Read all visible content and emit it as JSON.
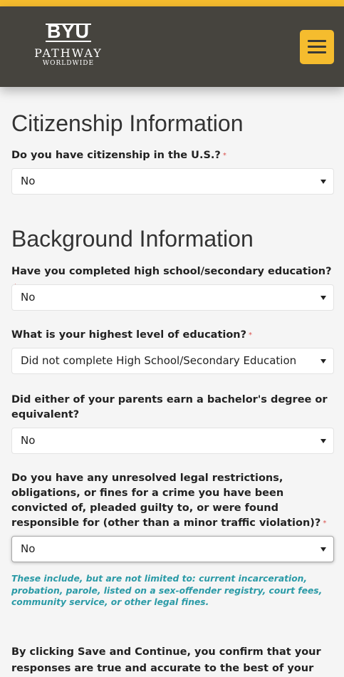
{
  "header": {
    "logo": {
      "line1": "BYU",
      "line2": "PATHWAY",
      "line3": "WORLDWIDE"
    },
    "menu_icon": "hamburger-menu-icon",
    "accent_color": "#f5bc2e",
    "bar_color": "#46443e"
  },
  "citizenship": {
    "title": "Citizenship Information",
    "q1": {
      "label": "Do you have citizenship in the U.S.?",
      "required": "*",
      "value": "No"
    }
  },
  "background": {
    "title": "Background Information",
    "q_highschool": {
      "label": "Have you completed high school/secondary education?",
      "required": "*",
      "value": "No"
    },
    "q_education": {
      "label": "What is your highest level of education?",
      "required": "*",
      "value": "Did not complete High School/Secondary Education"
    },
    "q_parents": {
      "label": "Did either of your parents earn a bachelor's degree or equivalent?",
      "value": "No"
    },
    "q_legal": {
      "label": "Do you have any unresolved legal restrictions, obligations, or fines for a crime you have been convicted of, pleaded guilty to, or were found responsible for (other than a minor traffic violation)?",
      "required": "*",
      "value": "No",
      "help": "These include, but are not limited to: current incarceration, probation, parole, listed on a sex-offender registry, court fees, community service, or other legal fines."
    }
  },
  "confirm_text": "By clicking Save and Continue, you confirm that your responses are true and accurate to the best of your"
}
